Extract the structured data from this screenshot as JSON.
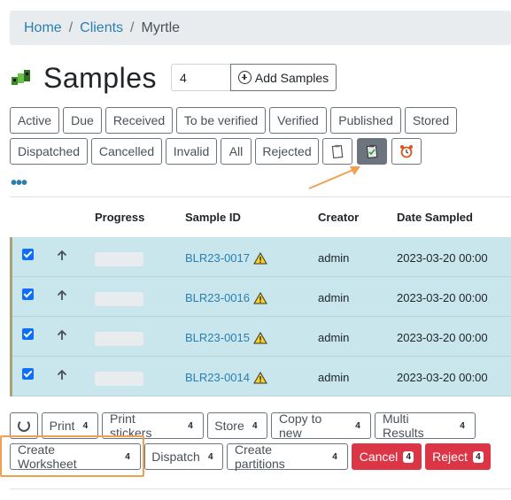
{
  "breadcrumb": {
    "home": "Home",
    "clients": "Clients",
    "current": "Myrtle"
  },
  "page": {
    "title": "Samples"
  },
  "add_samples": {
    "count_value": "4",
    "button_label": "Add Samples"
  },
  "filters": {
    "active": "Active",
    "due": "Due",
    "received": "Received",
    "to_be_verified": "To be verified",
    "verified": "Verified",
    "published": "Published",
    "stored": "Stored",
    "dispatched": "Dispatched",
    "cancelled": "Cancelled",
    "invalid": "Invalid",
    "all": "All",
    "rejected": "Rejected"
  },
  "filter_icons": [
    "clipboard-icon",
    "print-queue-icon",
    "alarm-clock-icon"
  ],
  "more_label": "•••",
  "table": {
    "headers": {
      "progress": "Progress",
      "sample_id": "Sample ID",
      "creator": "Creator",
      "date_sampled": "Date Sampled"
    },
    "rows": [
      {
        "sample_id": "BLR23-0017",
        "creator": "admin",
        "date_sampled": "2023-03-20 00:00"
      },
      {
        "sample_id": "BLR23-0016",
        "creator": "admin",
        "date_sampled": "2023-03-20 00:00"
      },
      {
        "sample_id": "BLR23-0015",
        "creator": "admin",
        "date_sampled": "2023-03-20 00:00"
      },
      {
        "sample_id": "BLR23-0014",
        "creator": "admin",
        "date_sampled": "2023-03-20 00:00"
      }
    ]
  },
  "actions": {
    "print": {
      "label": "Print",
      "count": "4"
    },
    "print_stickers": {
      "label": "Print stickers",
      "count": "4"
    },
    "store": {
      "label": "Store",
      "count": "4"
    },
    "copy_to_new": {
      "label": "Copy to new",
      "count": "4"
    },
    "multi_results": {
      "label": "Multi Results",
      "count": "4"
    },
    "create_worksheet": {
      "label": "Create Worksheet",
      "count": "4"
    },
    "dispatch": {
      "label": "Dispatch",
      "count": "4"
    },
    "create_partitions": {
      "label": "Create partitions",
      "count": "4"
    },
    "cancel": {
      "label": "Cancel",
      "count": "4"
    },
    "reject": {
      "label": "Reject",
      "count": "4"
    }
  },
  "colors": {
    "link": "#2a7fb0",
    "selected_row": "#c8e6ec",
    "danger": "#dc3545",
    "annotation": "#f0a050"
  }
}
